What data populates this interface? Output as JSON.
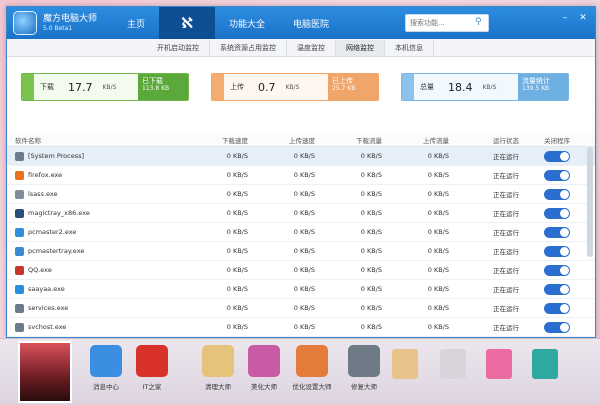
{
  "app": {
    "name": "魔方电脑大师",
    "version": "5.0  Beta1"
  },
  "nav": {
    "home": "主页",
    "features": "功能大全",
    "clinic": "电脑医院"
  },
  "search": {
    "placeholder": "搜索功能..."
  },
  "tabs": [
    "开机启动监控",
    "系统资源占用监控",
    "温度监控",
    "网络监控",
    "本机信息"
  ],
  "active_tab": 3,
  "stats": {
    "download": {
      "label": "下载",
      "value": "17.7",
      "unit": "KB/S",
      "total_label": "已下载",
      "total_value": "113.8 KB"
    },
    "upload": {
      "label": "上传",
      "value": "0.7",
      "unit": "KB/S",
      "total_label": "已上传",
      "total_value": "25.7 KB"
    },
    "total": {
      "label": "总量",
      "value": "18.4",
      "unit": "KB/S",
      "total_label": "流量统计",
      "total_value": "139.5 KB"
    }
  },
  "table": {
    "headers": [
      "软件名称",
      "下载速度",
      "上传速度",
      "下载流量",
      "上传流量",
      "运行状态",
      "关闭程序"
    ],
    "rows": [
      {
        "name": "[System Process]",
        "dl": "0 KB/S",
        "ul": "0 KB/S",
        "dlt": "0 KB/S",
        "ult": "0 KB/S",
        "status": "正在运行",
        "icon_color": "#6b7a8c"
      },
      {
        "name": "firefox.exe",
        "dl": "0 KB/S",
        "ul": "0 KB/S",
        "dlt": "0 KB/S",
        "ult": "0 KB/S",
        "status": "正在运行",
        "icon_color": "#e8731f"
      },
      {
        "name": "lsass.exe",
        "dl": "0 KB/S",
        "ul": "0 KB/S",
        "dlt": "0 KB/S",
        "ult": "0 KB/S",
        "status": "正在运行",
        "icon_color": "#7f8c99"
      },
      {
        "name": "magictray_x86.exe",
        "dl": "0 KB/S",
        "ul": "0 KB/S",
        "dlt": "0 KB/S",
        "ult": "0 KB/S",
        "status": "正在运行",
        "icon_color": "#2c4f7a"
      },
      {
        "name": "pcmaster2.exe",
        "dl": "0 KB/S",
        "ul": "0 KB/S",
        "dlt": "0 KB/S",
        "ult": "0 KB/S",
        "status": "正在运行",
        "icon_color": "#2f8fdc"
      },
      {
        "name": "pcmastertray.exe",
        "dl": "0 KB/S",
        "ul": "0 KB/S",
        "dlt": "0 KB/S",
        "ult": "0 KB/S",
        "status": "正在运行",
        "icon_color": "#3a8ad3"
      },
      {
        "name": "QQ.exe",
        "dl": "0 KB/S",
        "ul": "0 KB/S",
        "dlt": "0 KB/S",
        "ult": "0 KB/S",
        "status": "正在运行",
        "icon_color": "#c9352c"
      },
      {
        "name": "saayaa.exe",
        "dl": "0 KB/S",
        "ul": "0 KB/S",
        "dlt": "0 KB/S",
        "ult": "0 KB/S",
        "status": "正在运行",
        "icon_color": "#2a8ee0"
      },
      {
        "name": "services.exe",
        "dl": "0 KB/S",
        "ul": "0 KB/S",
        "dlt": "0 KB/S",
        "ult": "0 KB/S",
        "status": "正在运行",
        "icon_color": "#6b7a8c"
      },
      {
        "name": "svchost.exe",
        "dl": "0 KB/S",
        "ul": "0 KB/S",
        "dlt": "0 KB/S",
        "ult": "0 KB/S",
        "status": "正在运行",
        "icon_color": "#6b7a8c"
      }
    ]
  },
  "dock": {
    "items": [
      {
        "label": "消息中心",
        "color": "#3b8ee0"
      },
      {
        "label": "IT之家",
        "color": "#d8312a"
      },
      {
        "label": "清理大师",
        "color": "#e6c37a"
      },
      {
        "label": "美化大师",
        "color": "#c85aa6"
      },
      {
        "label": "优化设置大师",
        "color": "#e47b3a"
      },
      {
        "label": "修复大师",
        "color": "#6e7a86"
      }
    ]
  }
}
